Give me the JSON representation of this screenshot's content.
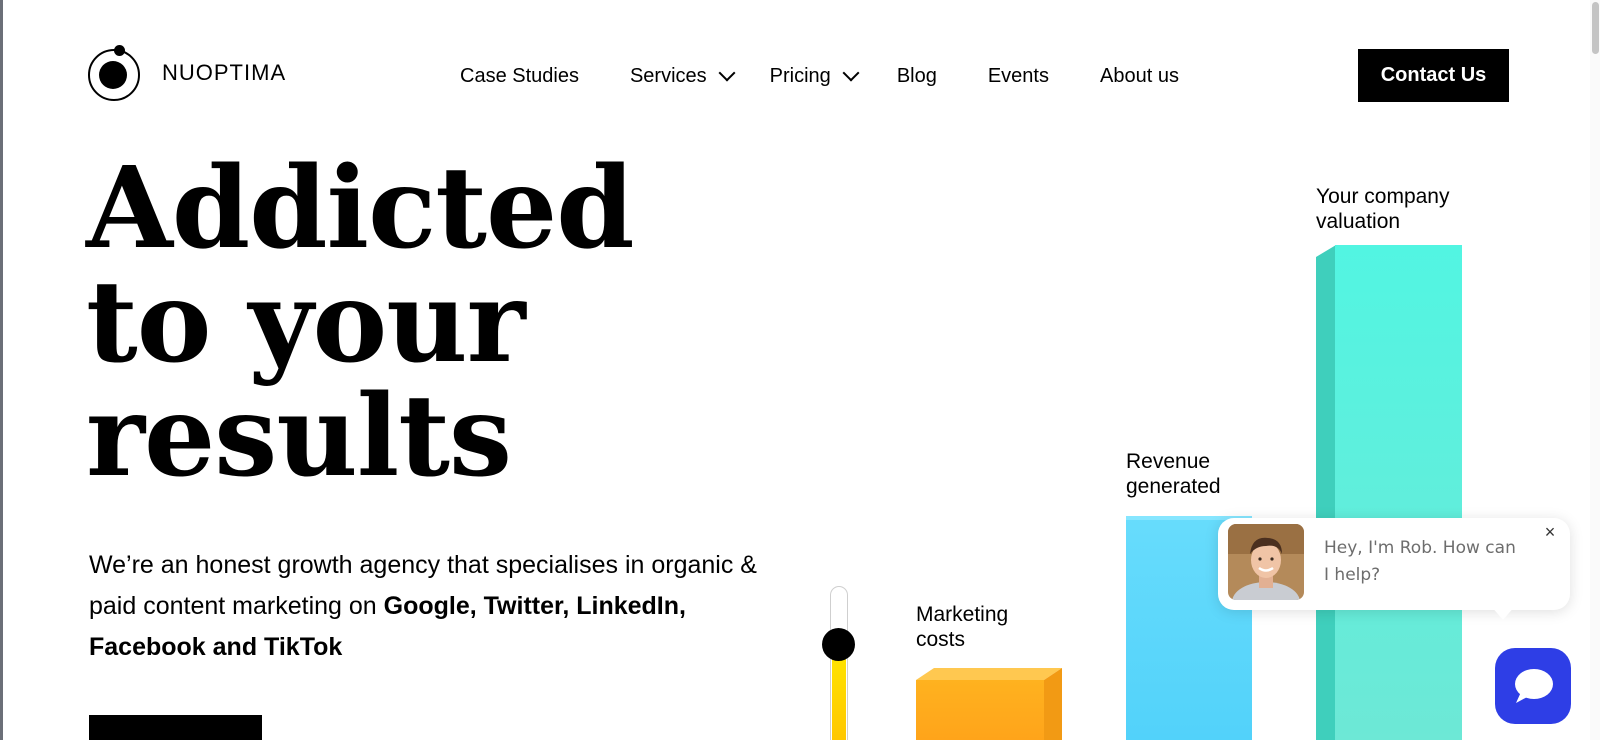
{
  "brand": {
    "name": "NUOPTIMA"
  },
  "nav": {
    "items": [
      {
        "label": "Case Studies",
        "has_dropdown": false
      },
      {
        "label": "Services",
        "has_dropdown": true
      },
      {
        "label": "Pricing",
        "has_dropdown": true
      },
      {
        "label": "Blog",
        "has_dropdown": false
      },
      {
        "label": "Events",
        "has_dropdown": false
      },
      {
        "label": "About us",
        "has_dropdown": false
      }
    ],
    "contact_label": "Contact Us"
  },
  "hero": {
    "headline_line1": "Addicted",
    "headline_line2": "to your",
    "headline_line3": "results",
    "sub_part1": "We’re an honest growth agency that specialises in organic & paid content marketing on ",
    "sub_bold": "Google, Twitter, LinkedIn, Facebook and TikTok"
  },
  "chart": {
    "marketing_label_1": "Marketing",
    "marketing_label_2": "costs",
    "revenue_label_1": "Revenue",
    "revenue_label_2": "generated",
    "valuation_label_1": "Your company",
    "valuation_label_2": "valuation",
    "colors": {
      "marketing": "#ffb21f",
      "revenue": "#5dd8fb",
      "valuation": "#52f2de",
      "slider": "#ffd400"
    }
  },
  "chat": {
    "message": "Hey, I'm Rob. How can I help?",
    "close_glyph": "×"
  }
}
